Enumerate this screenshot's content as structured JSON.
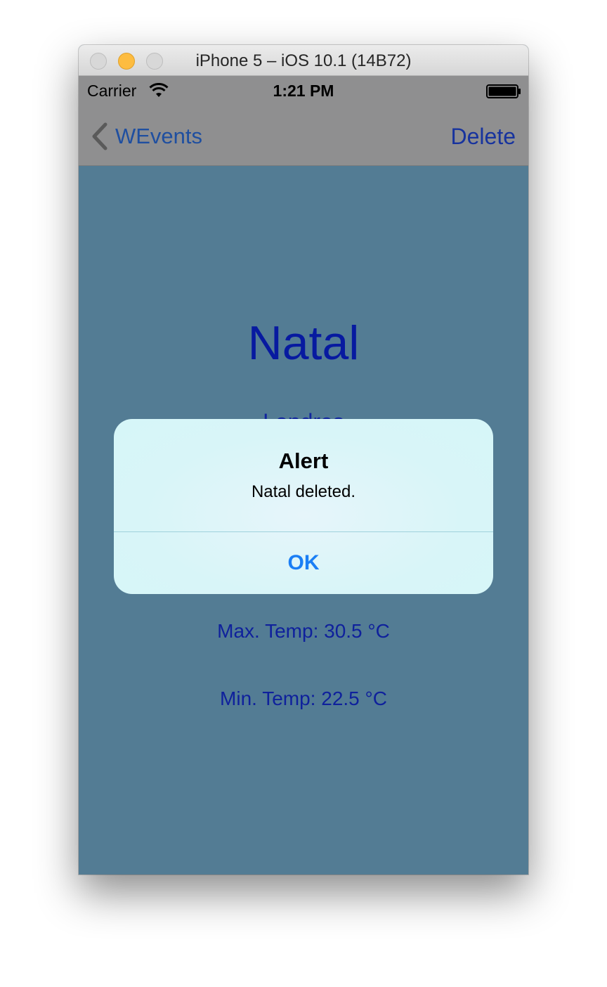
{
  "window": {
    "title": "iPhone 5 – iOS 10.1 (14B72)"
  },
  "status_bar": {
    "carrier": "Carrier",
    "time": "1:21 PM",
    "wifi_icon": "wifi-icon",
    "battery_icon": "battery-full-icon"
  },
  "nav_bar": {
    "back_label": "WEvents",
    "back_icon": "chevron-left-icon",
    "right_button_label": "Delete"
  },
  "event": {
    "name": "Natal",
    "location": "Londres",
    "max_temp": "Max. Temp: 30.5 °C",
    "min_temp": "Min. Temp: 22.5 °C"
  },
  "alert": {
    "title": "Alert",
    "message": "Natal deleted.",
    "ok_label": "OK"
  },
  "colors": {
    "background": "#537c94",
    "nav_background": "#8f8f90",
    "title_text": "#071aa0",
    "alert_button": "#1a7ef5",
    "alert_background": "#d8f5f8"
  }
}
